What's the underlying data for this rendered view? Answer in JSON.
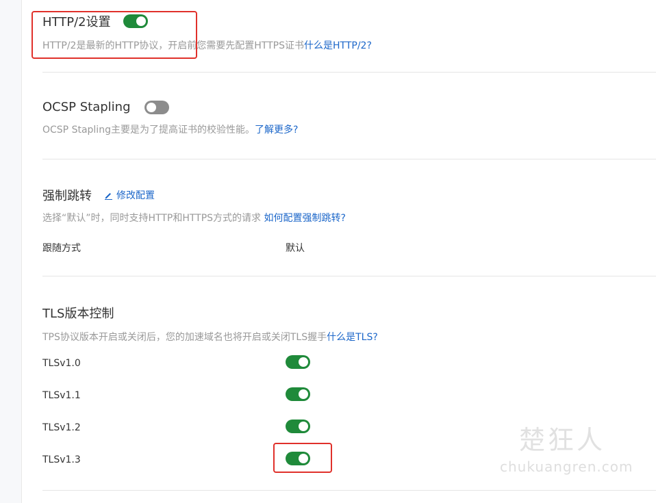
{
  "http2": {
    "title": "HTTP/2设置",
    "enabled": true,
    "desc": "HTTP/2是最新的HTTP协议，开启前您需要先配置HTTPS证书",
    "link": "什么是HTTP/2?"
  },
  "ocsp": {
    "title": "OCSP Stapling",
    "enabled": false,
    "desc": "OCSP Stapling主要是为了提高证书的校验性能。",
    "link": "了解更多?"
  },
  "redirect": {
    "title": "强制跳转",
    "edit_label": "修改配置",
    "desc": "选择“默认”时，同时支持HTTP和HTTPS方式的请求 ",
    "link": "如何配置强制跳转?",
    "rows": [
      {
        "label": "跟随方式",
        "value": "默认"
      }
    ]
  },
  "tls": {
    "title": "TLS版本控制",
    "desc": "TPS协议版本开启或关闭后，您的加速域名也将开启或关闭TLS握手",
    "link": "什么是TLS?",
    "versions": [
      {
        "label": "TLSv1.0",
        "enabled": true
      },
      {
        "label": "TLSv1.1",
        "enabled": true
      },
      {
        "label": "TLSv1.2",
        "enabled": true
      },
      {
        "label": "TLSv1.3",
        "enabled": true
      }
    ]
  },
  "watermark": {
    "cn": "楚狂人",
    "en": "chukuangren.com"
  },
  "colors": {
    "toggle_on": "#1f8a3a",
    "toggle_off": "#8c8c8c",
    "link": "#1b66c9",
    "highlight": "#e0302a"
  },
  "icons": {
    "edit": "pencil-icon"
  }
}
